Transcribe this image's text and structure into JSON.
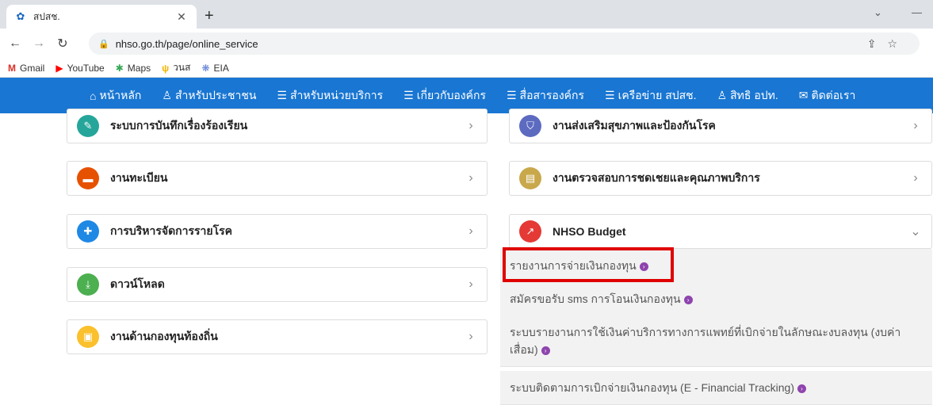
{
  "browser": {
    "tab_title": "สปสช.",
    "url": "nhso.go.th/page/online_service"
  },
  "bookmarks": [
    {
      "label": "Gmail",
      "icon": "gmail-icon",
      "color": "#d93025",
      "glyph": "M"
    },
    {
      "label": "YouTube",
      "icon": "youtube-icon",
      "color": "#ff0000",
      "glyph": "▶"
    },
    {
      "label": "Maps",
      "icon": "maps-icon",
      "color": "#34a853",
      "glyph": "✱"
    },
    {
      "label": "วนส",
      "icon": "vns-icon",
      "color": "#f4b400",
      "glyph": "ψ"
    },
    {
      "label": "EIA",
      "icon": "eia-icon",
      "color": "#5b7bd5",
      "glyph": "❋"
    }
  ],
  "sitenav": {
    "items": [
      {
        "label": "หน้าหลัก",
        "glyph": "⌂"
      },
      {
        "label": "สำหรับประชาชน",
        "glyph": "♙"
      },
      {
        "label": "สำหรับหน่วยบริการ",
        "glyph": "☰"
      },
      {
        "label": "เกี่ยวกับองค์กร",
        "glyph": "☰"
      },
      {
        "label": "สื่อสารองค์กร",
        "glyph": "☰"
      },
      {
        "label": "เครือข่าย สปสช.",
        "glyph": "☰"
      },
      {
        "label": "สิทธิ อปท.",
        "glyph": "♙"
      },
      {
        "label": "ติดต่อเรา",
        "glyph": "✉"
      }
    ],
    "bg_color": "#1976d2"
  },
  "left_cards": [
    {
      "label": "ระบบการบันทึกเรื่องร้องเรียน",
      "icon": "complaint-icon",
      "color": "#26a69a",
      "glyph": "✎"
    },
    {
      "label": "งานทะเบียน",
      "icon": "registry-icon",
      "color": "#e65100",
      "glyph": "▬"
    },
    {
      "label": "การบริหารจัดการรายโรค",
      "icon": "disease-icon",
      "color": "#1e88e5",
      "glyph": "✚"
    },
    {
      "label": "ดาวน์โหลด",
      "icon": "download-icon",
      "color": "#4caf50",
      "glyph": "⤓"
    },
    {
      "label": "งานด้านกองทุนท้องถิ่น",
      "icon": "local-fund-icon",
      "color": "#fbc02d",
      "glyph": "▣"
    }
  ],
  "right_cards": [
    {
      "label": "งานส่งเสริมสุขภาพและป้องกันโรค",
      "icon": "shield-icon",
      "color": "#5c6bc0",
      "glyph": "⛉"
    },
    {
      "label": "งานตรวจสอบการชดเชยและคุณภาพบริการ",
      "icon": "audit-icon",
      "color": "#c9a84c",
      "glyph": "▤"
    },
    {
      "label": "NHSO Budget",
      "icon": "budget-icon",
      "color": "#e53935",
      "glyph": "↗"
    }
  ],
  "budget_sub": [
    {
      "label": "รายงานการจ่ายเงินกองทุน"
    },
    {
      "label": "สมัครขอรับ sms การโอนเงินกองทุน"
    },
    {
      "label": "ระบบรายงานการใช้เงินค่าบริการทางการแพทย์ที่เบิกจ่ายในลักษณะงบลงทุน (งบค่าเสื่อม)"
    },
    {
      "label": "ระบบติดตามการเบิกจ่ายเงินกองทุน (E - Financial Tracking)"
    }
  ],
  "highlight_color": "#e00000"
}
